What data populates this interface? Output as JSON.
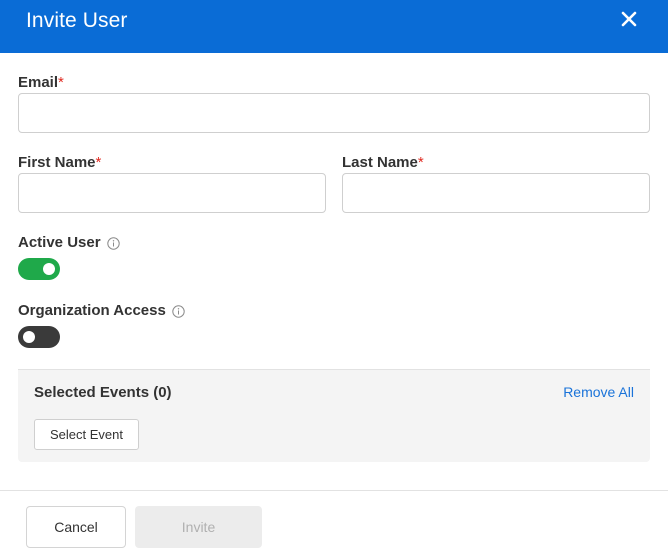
{
  "header": {
    "title": "Invite User",
    "close_icon": "close-icon"
  },
  "form": {
    "email": {
      "label": "Email",
      "required_mark": "*",
      "value": "",
      "placeholder": ""
    },
    "first_name": {
      "label": "First Name",
      "required_mark": "*",
      "value": "",
      "placeholder": ""
    },
    "last_name": {
      "label": "Last Name",
      "required_mark": "*",
      "value": "",
      "placeholder": ""
    },
    "active_user": {
      "label": "Active User",
      "info_icon": "info-icon",
      "enabled": true
    },
    "organization_access": {
      "label": "Organization Access",
      "info_icon": "info-icon",
      "enabled": false
    }
  },
  "events": {
    "title": "Selected Events (0)",
    "remove_all_label": "Remove All",
    "select_event_label": "Select Event"
  },
  "footer": {
    "cancel_label": "Cancel",
    "invite_label": "Invite"
  },
  "colors": {
    "brand": "#0a6cd6",
    "toggle_on": "#1fa94a",
    "toggle_off": "#3a3a3a",
    "required": "#e0281f",
    "link": "#1a73d9"
  }
}
